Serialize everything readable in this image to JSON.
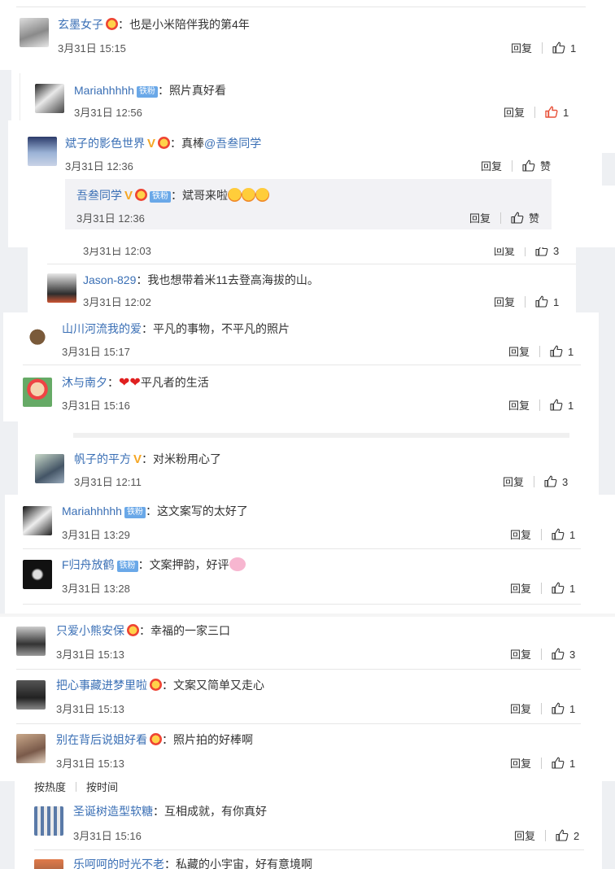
{
  "comments": [
    {
      "user": "玄墨女子",
      "text": "也是小米陪伴我的第4年",
      "time": "3月31日 15:15",
      "reply": "回复",
      "like": "1"
    },
    {
      "user": "Mariahhhhh",
      "badge": "铁粉",
      "text": "照片真好看",
      "time": "3月31日 12:56",
      "reply": "回复",
      "like": "1"
    },
    {
      "user": "斌子的影色世界",
      "text": "真棒",
      "mention": "@吾叁同学",
      "time": "3月31日 12:36",
      "reply": "回复",
      "like": "赞"
    },
    {
      "user": "吾叁同学",
      "badge": "铁粉",
      "text": "斌哥来啦",
      "time": "3月31日 12:36",
      "reply": "回复",
      "like": "赞"
    },
    {
      "time": "3月31日 12:03",
      "reply": "回复",
      "like": "3"
    },
    {
      "user": "Jason-829",
      "text": "我也想带着米11去登高海拔的山。",
      "time": "3月31日 12:02",
      "reply": "回复",
      "like": "1"
    },
    {
      "user": "山川河流我的爱",
      "text": "平凡的事物，不平凡的照片",
      "time": "3月31日 15:17",
      "reply": "回复",
      "like": "1"
    },
    {
      "user": "沐与南夕",
      "text": "平凡者的生活",
      "time": "3月31日 15:16",
      "reply": "回复",
      "like": "1"
    },
    {
      "user": "帆子的平方",
      "text": "对米粉用心了",
      "time": "3月31日 12:11",
      "reply": "回复",
      "like": "3"
    },
    {
      "user": "Mariahhhhh",
      "badge": "铁粉",
      "text": "这文案写的太好了",
      "time": "3月31日 13:29",
      "reply": "回复",
      "like": "1"
    },
    {
      "user": "F归舟放鹤",
      "badge": "铁粉",
      "text": "文案押韵，好评",
      "time": "3月31日 13:28",
      "reply": "回复",
      "like": "1"
    },
    {
      "user": "只爱小熊安保",
      "text": "幸福的一家三口",
      "time": "3月31日 15:13",
      "reply": "回复",
      "like": "3"
    },
    {
      "user": "把心事藏进梦里啦",
      "text": "文案又简单又走心",
      "time": "3月31日 15:13",
      "reply": "回复",
      "like": "1"
    },
    {
      "user": "别在背后说姐好看",
      "text": "照片拍的好棒啊",
      "time": "3月31日 15:13",
      "reply": "回复",
      "like": "1"
    },
    {
      "user": "圣诞树造型软糖",
      "text": "互相成就，有你真好",
      "time": "3月31日 15:16",
      "reply": "回复",
      "like": "2"
    },
    {
      "user": "乐呵呵的时光不老",
      "text": "私藏的小宇宙，好有意境啊"
    }
  ],
  "sort": {
    "hot": "按热度",
    "time": "按时间"
  },
  "colon": "：",
  "colors": {
    "link": "#3a6fb5",
    "panel_gray": "#f2f2f5",
    "vip": "#f5a623"
  }
}
